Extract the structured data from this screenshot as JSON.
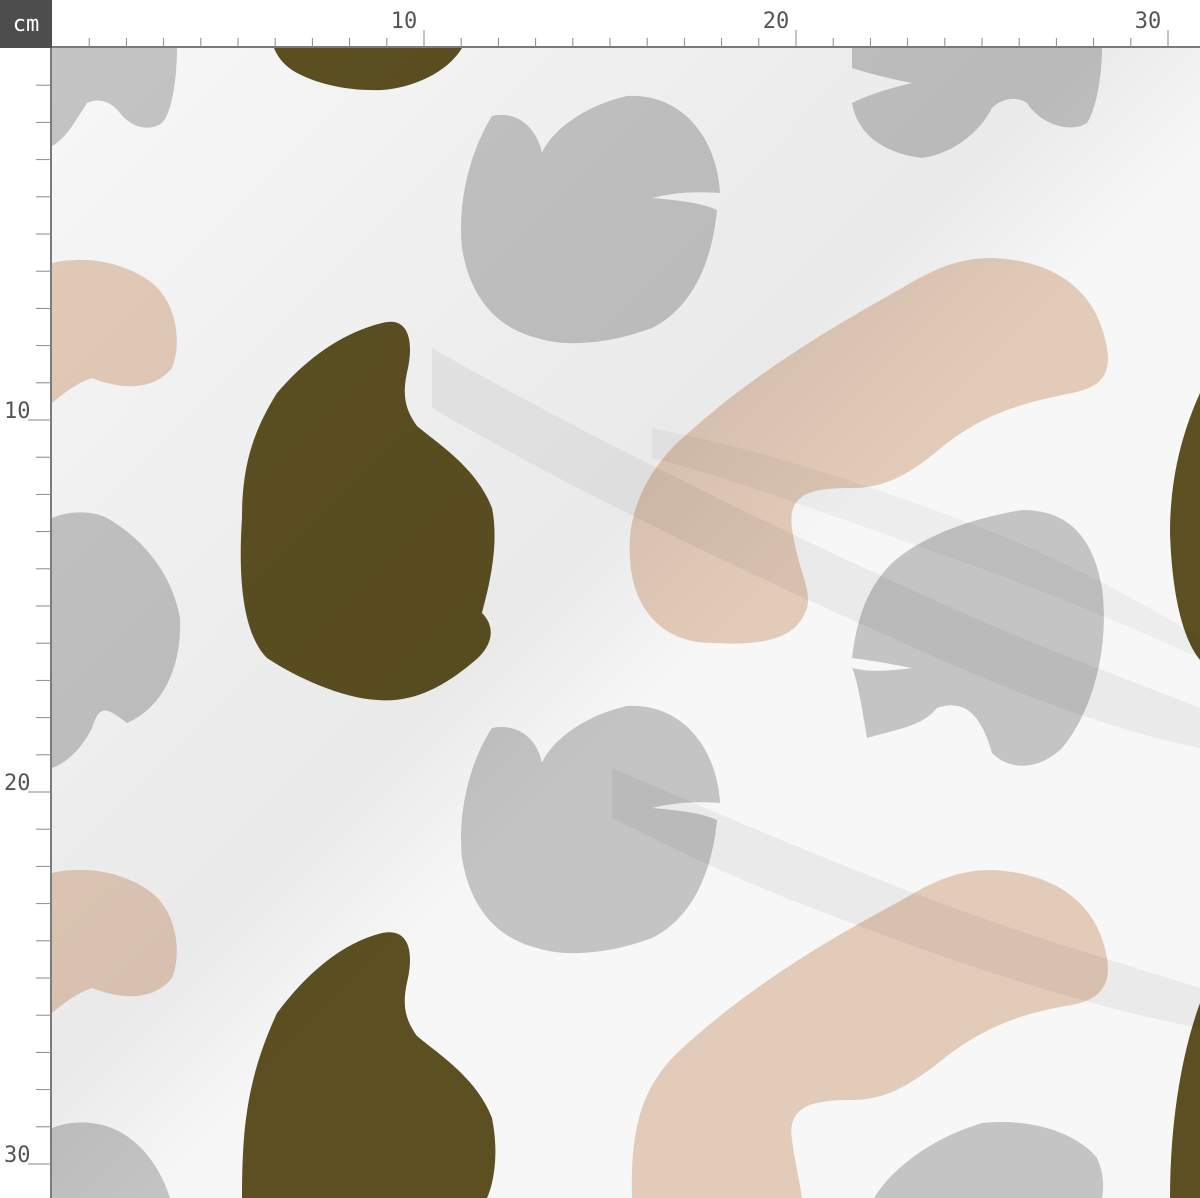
{
  "ruler": {
    "unit": "cm",
    "top_labels": [
      "10",
      "20",
      "30"
    ],
    "left_labels": [
      "10",
      "20",
      "30"
    ]
  },
  "pattern": {
    "colors": {
      "background": "#f7f7f7",
      "olive": "#5c5022",
      "gray": "#c4c4c4",
      "peach": "#e3cbb9",
      "ruler_line": "#7a7a7a",
      "badge": "#4d4d4d"
    }
  }
}
